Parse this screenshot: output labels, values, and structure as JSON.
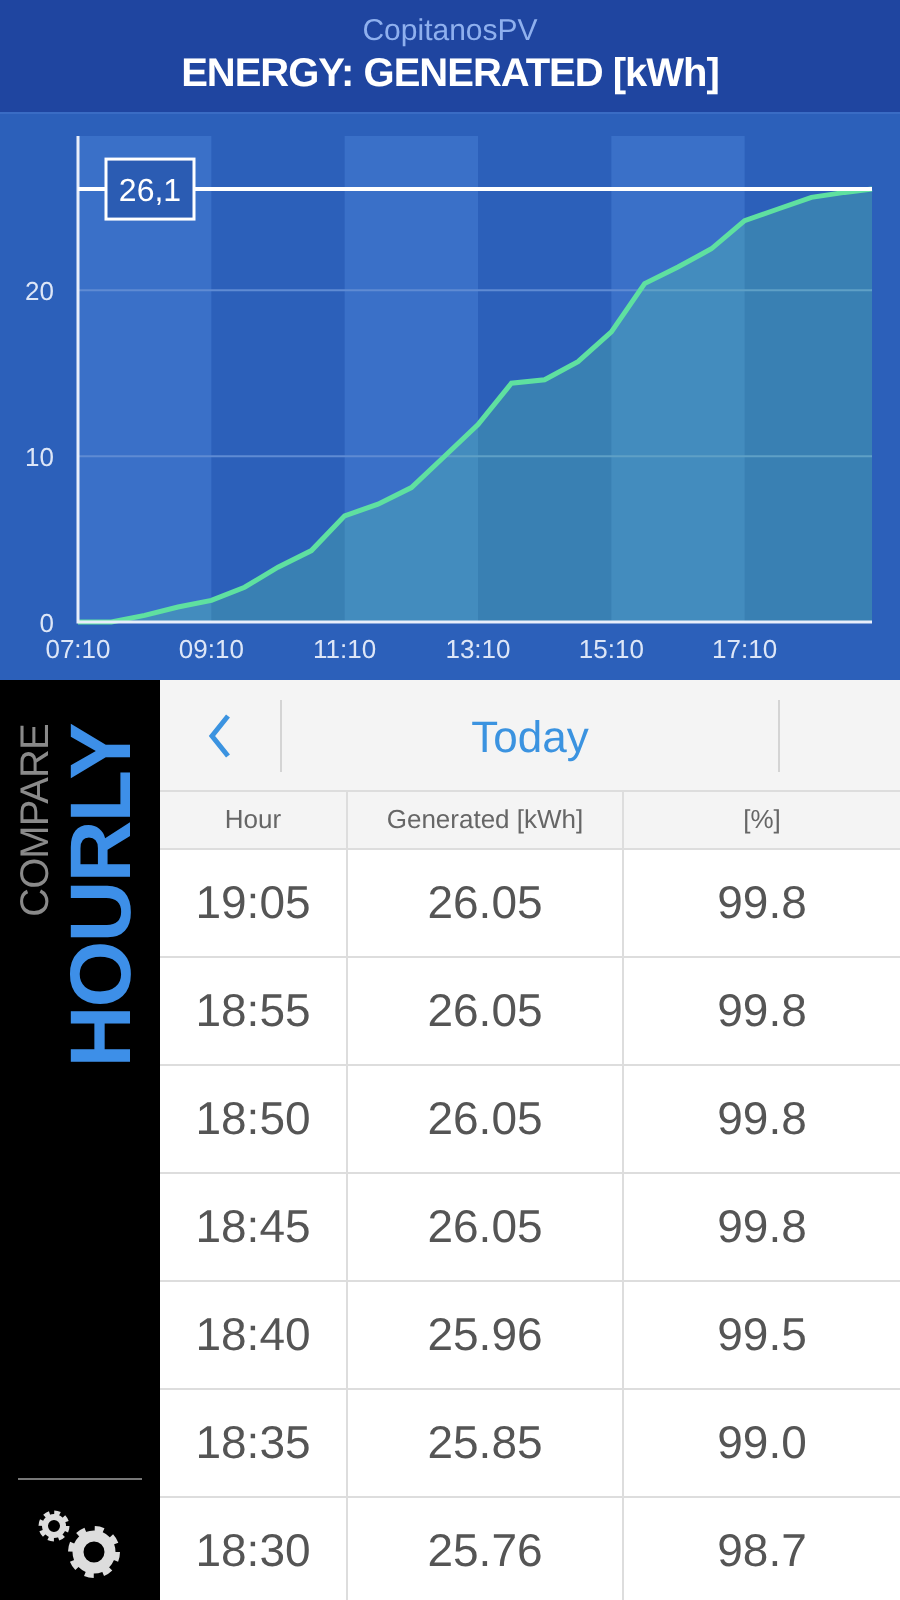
{
  "header": {
    "app_name": "CopitanosPV",
    "title": "ENERGY: GENERATED [kWh]"
  },
  "chart": {
    "chart_data": {
      "type": "area",
      "x": [
        7.17,
        7.67,
        8.17,
        8.67,
        9.17,
        9.67,
        10.17,
        10.67,
        11.17,
        11.67,
        12.17,
        12.67,
        13.17,
        13.67,
        14.17,
        14.67,
        15.17,
        15.67,
        16.17,
        16.67,
        17.17,
        17.67,
        18.17,
        18.67,
        19.08
      ],
      "series": [
        {
          "color": "#5fe0a0",
          "values": [
            0,
            0,
            0.4,
            0.9,
            1.3,
            2.1,
            3.3,
            4.3,
            6.4,
            7.1,
            8.1,
            10.0,
            11.9,
            14.4,
            14.6,
            15.7,
            17.5,
            20.4,
            21.4,
            22.5,
            24.2,
            24.9,
            25.6,
            25.9,
            26.1
          ]
        }
      ],
      "xlim": [
        7.17,
        19.08
      ],
      "ylim": [
        0,
        29.3
      ],
      "xticks": [
        {
          "value": 7.17,
          "label": "07:10"
        },
        {
          "value": 9.17,
          "label": "09:10"
        },
        {
          "value": 11.17,
          "label": "11:10"
        },
        {
          "value": 13.17,
          "label": "13:10"
        },
        {
          "value": 15.17,
          "label": "15:10"
        },
        {
          "value": 17.17,
          "label": "17:10"
        }
      ],
      "yticks": [
        0,
        10,
        20
      ],
      "bands": [
        {
          "axis": "x",
          "from": 7.17,
          "to": 9.17
        },
        {
          "axis": "x",
          "from": 11.17,
          "to": 13.17
        },
        {
          "axis": "x",
          "from": 15.17,
          "to": 17.17
        }
      ],
      "ref_lines": [
        {
          "axis": "y",
          "value": 26.1,
          "label": "26,1"
        }
      ]
    }
  },
  "sidebar": {
    "label": "COMPARE",
    "mode": "HOURLY"
  },
  "date_nav": {
    "label": "Today"
  },
  "table": {
    "columns": [
      "Hour",
      "Generated [kWh]",
      "[%]"
    ],
    "rows": [
      [
        "19:05",
        "26.05",
        "99.8"
      ],
      [
        "18:55",
        "26.05",
        "99.8"
      ],
      [
        "18:50",
        "26.05",
        "99.8"
      ],
      [
        "18:45",
        "26.05",
        "99.8"
      ],
      [
        "18:40",
        "25.96",
        "99.5"
      ],
      [
        "18:35",
        "25.85",
        "99.0"
      ],
      [
        "18:30",
        "25.76",
        "98.7"
      ]
    ]
  }
}
